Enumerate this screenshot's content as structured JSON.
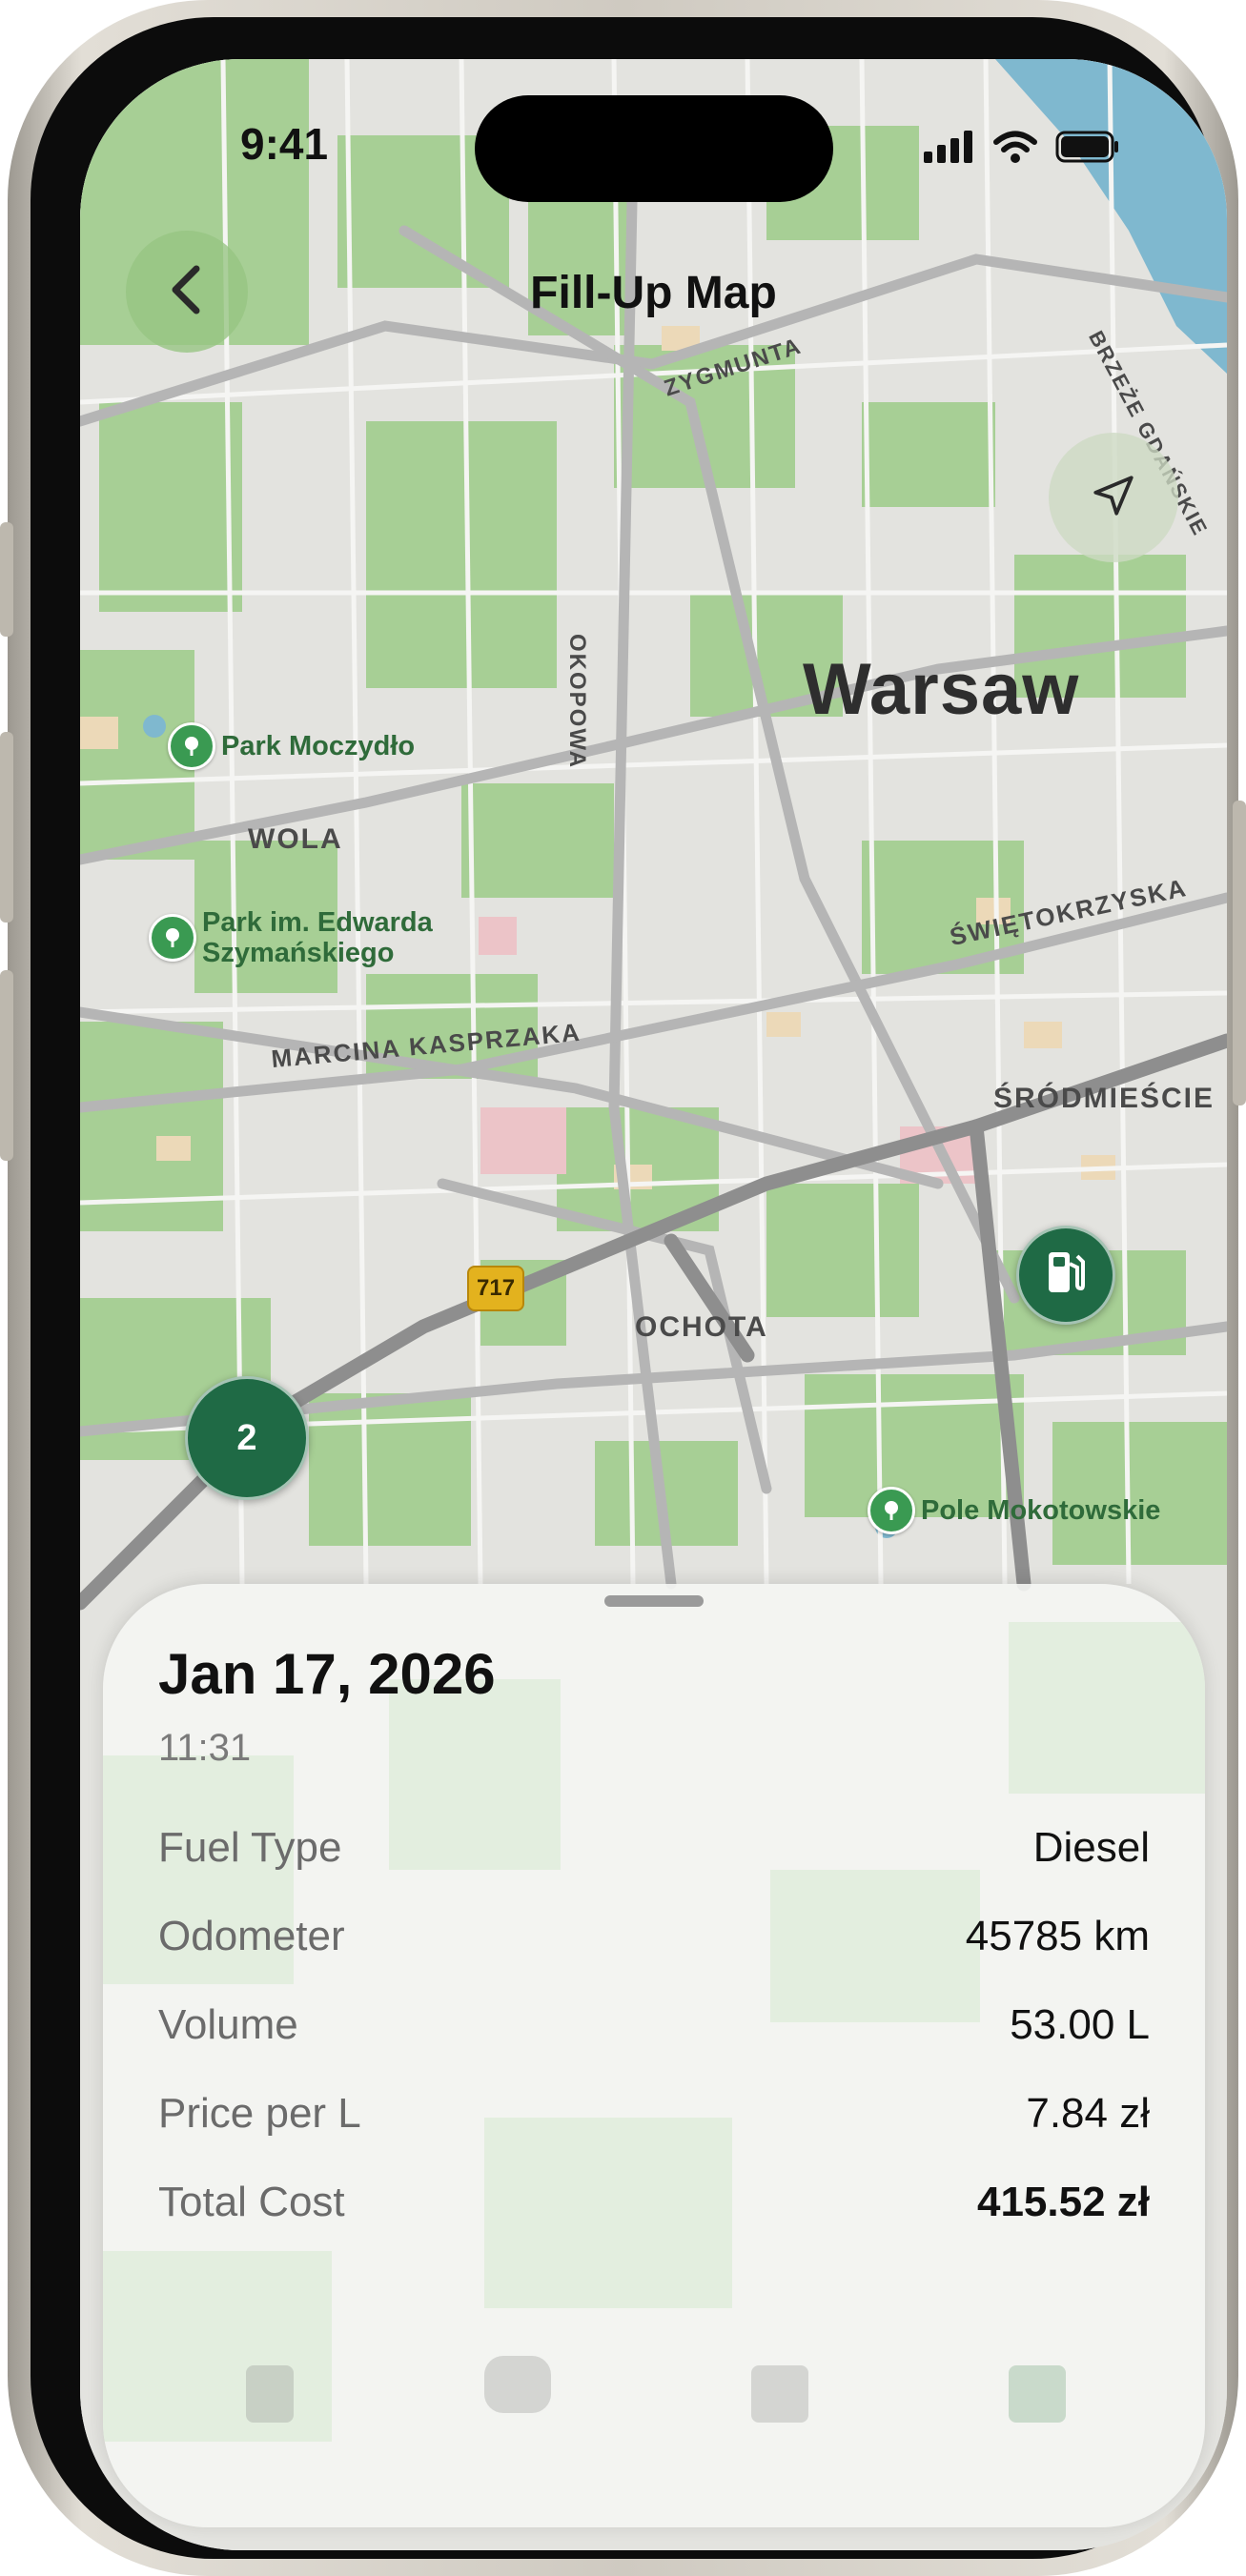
{
  "status_bar": {
    "time": "9:41"
  },
  "nav": {
    "title": "Fill-Up Map"
  },
  "map": {
    "city": "Warsaw",
    "districts": [
      "WOLA",
      "ŚRÓDMIEŚCIE",
      "OCHOTA"
    ],
    "streets": [
      "ZYGMUNTA",
      "OKOPOWA",
      "BRZEŻE GDAŃSKIE",
      "ŚWIĘTOKRZYSKA",
      "MARCINA KASPRZAKA"
    ],
    "parks": [
      "Park Moczydło",
      "Park im. Edwarda",
      "Szymańskiego",
      "Pole Mokotowskie"
    ],
    "road_shield": "717",
    "cluster_count": "2"
  },
  "sheet": {
    "date": "Jan 17, 2026",
    "time": "11:31",
    "rows": [
      {
        "label": "Fuel Type",
        "value": "Diesel"
      },
      {
        "label": "Odometer",
        "value": "45785 km"
      },
      {
        "label": "Volume",
        "value": "53.00 L"
      },
      {
        "label": "Price per L",
        "value": "7.84 zł"
      },
      {
        "label": "Total Cost",
        "value": "415.52 zł"
      }
    ]
  },
  "colors": {
    "marker": "#1f6a45",
    "park": "#3a9a52",
    "water": "#7fb8cf"
  }
}
